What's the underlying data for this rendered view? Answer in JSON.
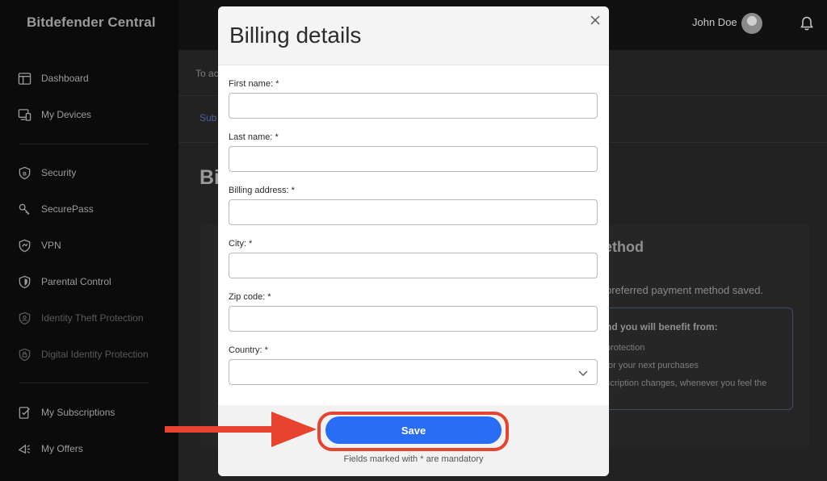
{
  "sidebar": {
    "brand": "Bitdefender Central",
    "items": [
      {
        "label": "Dashboard",
        "icon": "dashboard-icon"
      },
      {
        "label": "My Devices",
        "icon": "devices-icon"
      },
      {
        "label": "Security",
        "icon": "shield-b-icon"
      },
      {
        "label": "SecurePass",
        "icon": "key-icon"
      },
      {
        "label": "VPN",
        "icon": "vpn-shield-icon"
      },
      {
        "label": "Parental Control",
        "icon": "parental-shield-icon"
      },
      {
        "label": "Identity Theft Protection",
        "icon": "identity-shield-icon"
      },
      {
        "label": "Digital Identity Protection",
        "icon": "digital-identity-icon"
      },
      {
        "label": "My Subscriptions",
        "icon": "subscriptions-icon"
      },
      {
        "label": "My Offers",
        "icon": "offers-icon"
      }
    ]
  },
  "header": {
    "user_name": "John Doe",
    "avatar_icon": "avatar-icon",
    "bell_icon": "bell-icon"
  },
  "background": {
    "notice_partial": "To ac",
    "breadcrumb_partial": "Sub",
    "heading_partial": "Bi",
    "card_title_partial": "ethod",
    "card_text_partial": "preferred payment method saved.",
    "benefits_title_partial": "nd you will benefit from:",
    "benefits": [
      "protection",
      "for your next purchases",
      "scription changes, whenever you feel the"
    ]
  },
  "modal": {
    "title": "Billing details",
    "close_icon": "close-icon",
    "fields": {
      "first_name": {
        "label": "First name: *",
        "value": ""
      },
      "last_name": {
        "label": "Last name: *",
        "value": ""
      },
      "billing_address": {
        "label": "Billing address: *",
        "value": ""
      },
      "city": {
        "label": "City: *",
        "value": ""
      },
      "zip_code": {
        "label": "Zip code: *",
        "value": ""
      },
      "country": {
        "label": "Country: *",
        "value": ""
      }
    },
    "save_label": "Save",
    "mandatory_note": "Fields marked with * are mandatory"
  },
  "colors": {
    "accent": "#2a6df5",
    "highlight": "#e8432e"
  }
}
